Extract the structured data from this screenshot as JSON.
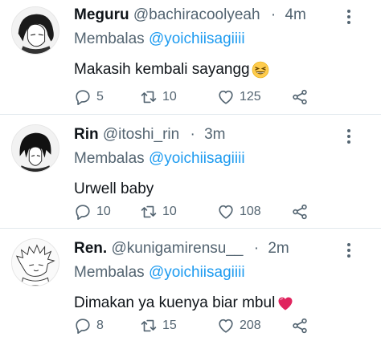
{
  "colors": {
    "name": "#0f1419",
    "muted": "#536471",
    "mention": "#1d9bf0",
    "divider": "#e1e8ed",
    "heart_emoji": "#e0245e"
  },
  "icons": {
    "reply": "speech-bubble-icon",
    "retweet": "retweet-arrows-icon",
    "like": "heart-outline-icon",
    "share": "share-nodes-icon",
    "more": "vertical-ellipsis-icon"
  },
  "tweets": [
    {
      "name": "Meguru",
      "handle": "@bachiracoolyeah",
      "dot": "·",
      "time": "4m",
      "reply_prefix": "Membalas",
      "reply_to": "@yoichiisagiiii",
      "text": "Makasih kembali sayangg",
      "emoji": "grinning-squinting-face-emoji",
      "replies": "5",
      "retweets": "10",
      "likes": "125"
    },
    {
      "name": "Rin",
      "handle": "@itoshi_rin",
      "dot": "·",
      "time": "3m",
      "reply_prefix": "Membalas",
      "reply_to": "@yoichiisagiiii",
      "text": "Urwell baby",
      "emoji": "",
      "replies": "10",
      "retweets": "10",
      "likes": "108"
    },
    {
      "name": "Ren.",
      "handle": "@kunigamirensu__",
      "dot": "·",
      "time": "2m",
      "reply_prefix": "Membalas",
      "reply_to": "@yoichiisagiiii",
      "text": "Dimakan ya kuenya biar mbul",
      "emoji": "red-heart-emoji",
      "replies": "8",
      "retweets": "15",
      "likes": "208"
    }
  ]
}
